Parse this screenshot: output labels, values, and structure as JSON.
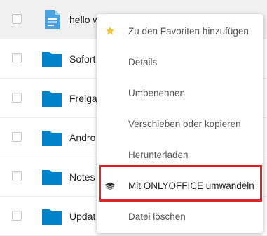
{
  "files": [
    {
      "name": "hello w",
      "type": "document",
      "selected": true
    },
    {
      "name": "Sofort",
      "type": "folder"
    },
    {
      "name": "Freigal",
      "type": "folder"
    },
    {
      "name": "Andro",
      "type": "folder"
    },
    {
      "name": "Notes",
      "type": "folder"
    },
    {
      "name": "Updat",
      "type": "folder"
    }
  ],
  "context_menu": {
    "items": [
      {
        "label": "Zu den Favoriten hinzufügen",
        "icon": "star-icon"
      },
      {
        "label": "Details"
      },
      {
        "label": "Umbenennen"
      },
      {
        "label": "Verschieben oder kopieren"
      },
      {
        "label": "Herunterladen"
      },
      {
        "label": "Mit ONLYOFFICE umwandeln",
        "icon": "layers-icon",
        "highlighted": true
      },
      {
        "label": "Datei löschen"
      }
    ]
  },
  "colors": {
    "folder": "#0082c9",
    "document": "#4aa3df",
    "star": "#f2c33a",
    "highlight_border": "#e0242b"
  }
}
